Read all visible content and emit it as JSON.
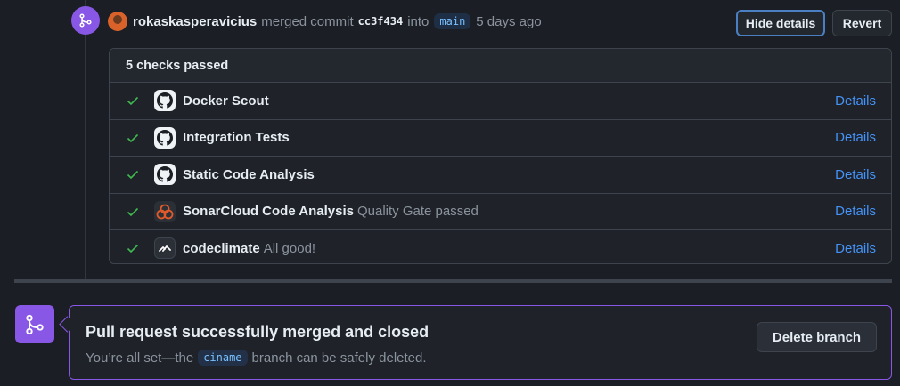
{
  "event": {
    "author": "rokaskasperavicius",
    "action": "merged commit",
    "commit_sha": "cc3f434",
    "into": "into",
    "target_branch": "main",
    "time": "5 days ago",
    "hide_details_label": "Hide details",
    "revert_label": "Revert"
  },
  "checks": {
    "summary": "5 checks passed",
    "details_label": "Details",
    "items": [
      {
        "name": "Docker Scout",
        "description": "",
        "icon": "github-icon"
      },
      {
        "name": "Integration Tests",
        "description": "",
        "icon": "github-icon"
      },
      {
        "name": "Static Code Analysis",
        "description": "",
        "icon": "github-icon"
      },
      {
        "name": "SonarCloud Code Analysis",
        "description": "Quality Gate passed",
        "icon": "sonarcloud-icon"
      },
      {
        "name": "codeclimate",
        "description": "All good!",
        "icon": "codeclimate-icon"
      }
    ]
  },
  "merged": {
    "title": "Pull request successfully merged and closed",
    "sub_prefix": "You’re all set—the",
    "branch": "ciname",
    "sub_suffix": "branch can be safely deleted.",
    "delete_label": "Delete branch"
  },
  "colors": {
    "accent_purple": "#8957e5",
    "success_green": "#3fb950",
    "link_blue": "#4493f8"
  }
}
